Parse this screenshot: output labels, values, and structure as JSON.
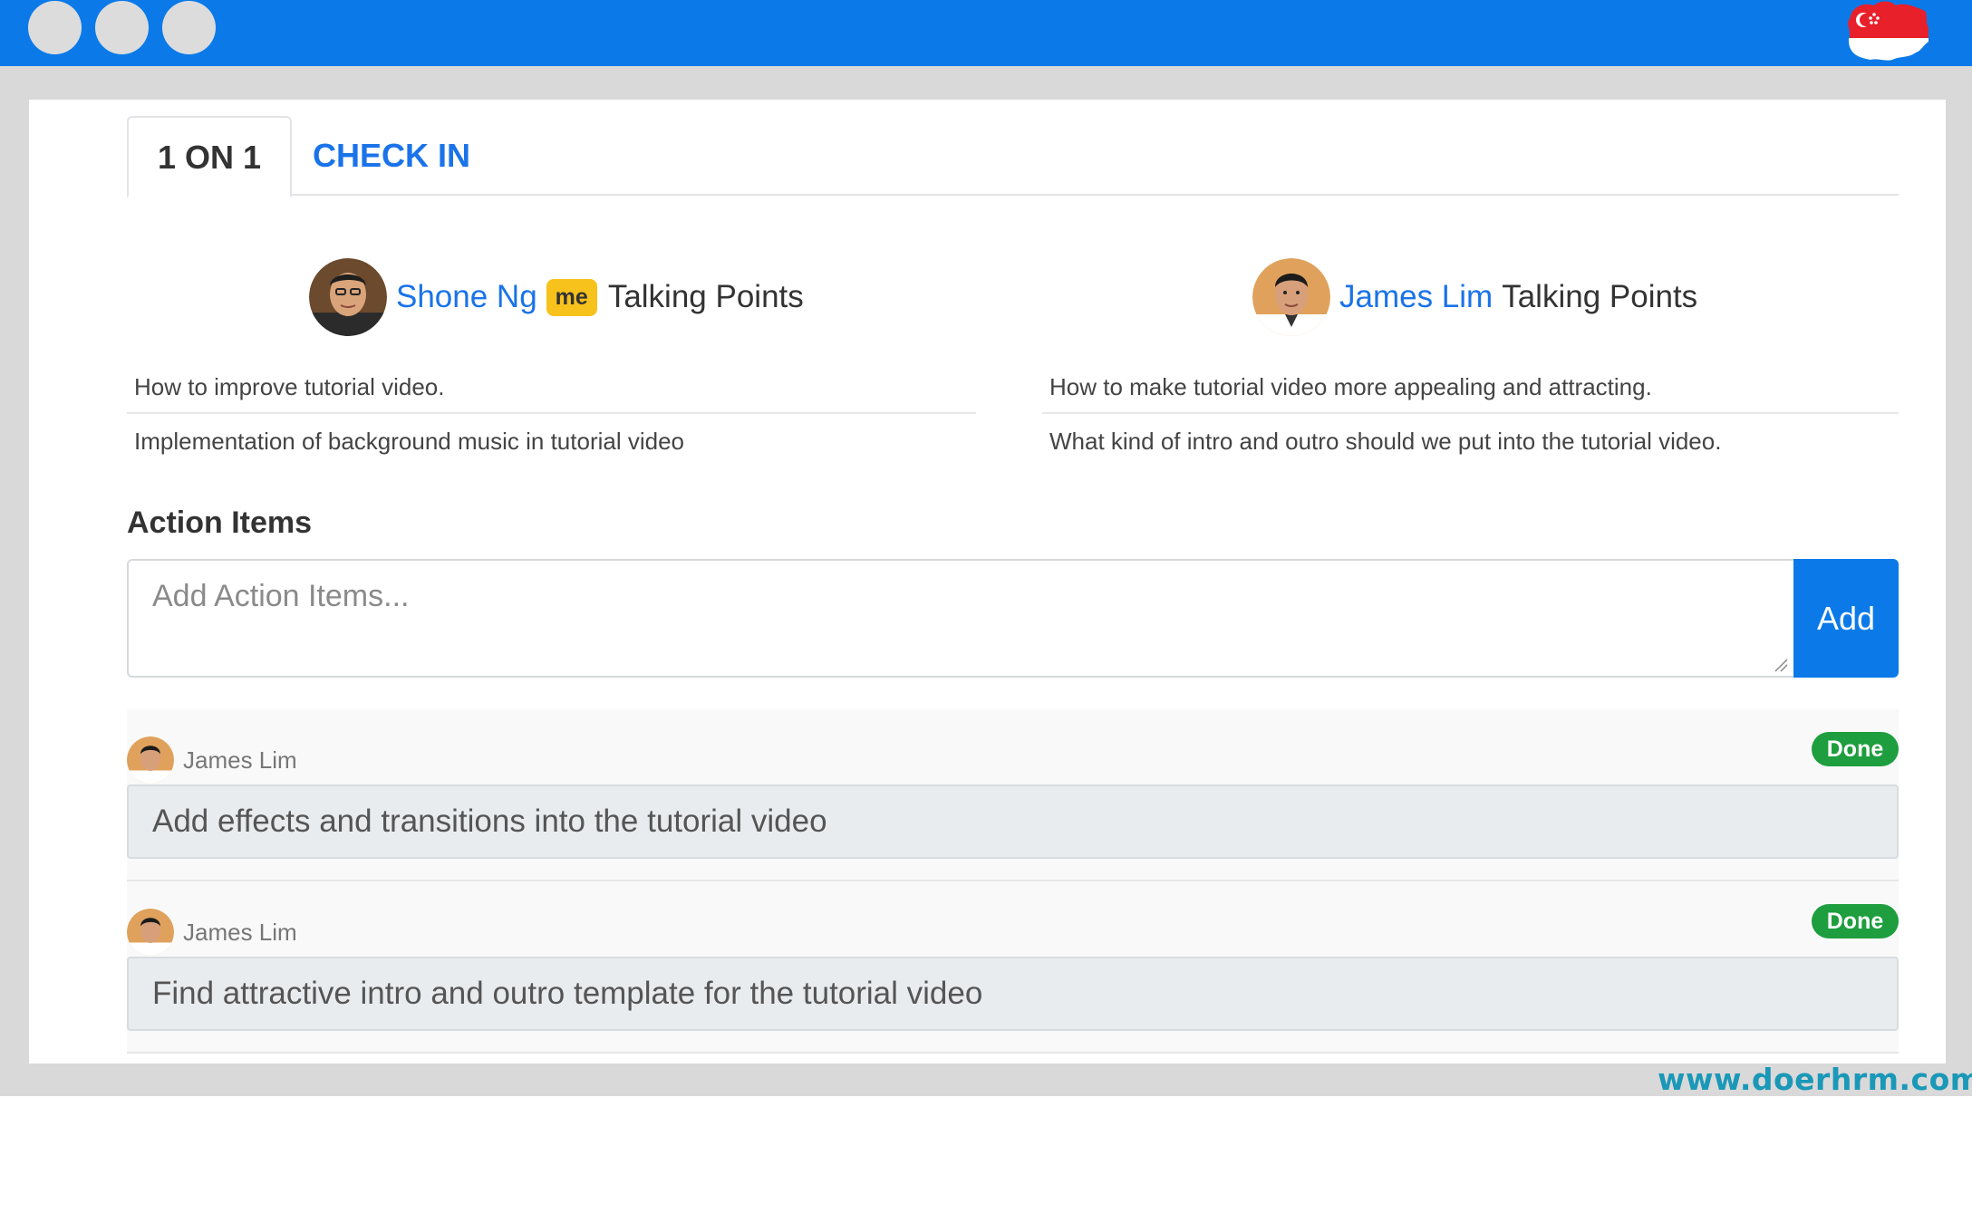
{
  "window": {
    "controls": [
      "window-dot-1",
      "window-dot-2",
      "window-dot-3"
    ],
    "flag_icon": "singapore-map-flag-icon"
  },
  "tabs": [
    {
      "label": "1 ON 1",
      "active": true
    },
    {
      "label": "CHECK IN",
      "active": false
    }
  ],
  "talking_points": {
    "left": {
      "name": "Shone Ng",
      "badge": "me",
      "suffix": "Talking Points",
      "items": [
        "How to improve tutorial video.",
        "Implementation of background music in tutorial video"
      ]
    },
    "right": {
      "name": "James Lim",
      "suffix": "Talking Points",
      "items": [
        "How to make tutorial video more appealing and attracting.",
        "What kind of intro and outro should we put into the tutorial video."
      ]
    }
  },
  "action_items": {
    "title": "Action Items",
    "input_placeholder": "Add Action Items...",
    "add_label": "Add",
    "items": [
      {
        "user": "James Lim",
        "status": "Done",
        "text": "Add effects and transitions into the tutorial video"
      },
      {
        "user": "James Lim",
        "status": "Done",
        "text": "Find attractive intro and outro template for the tutorial video"
      }
    ]
  },
  "footer": {
    "url": "www.doerhrm.com.sg"
  },
  "colors": {
    "accent": "#0b7ae8",
    "link": "#1a73e8",
    "done": "#1e9e3e",
    "me_badge": "#f7c21b"
  }
}
